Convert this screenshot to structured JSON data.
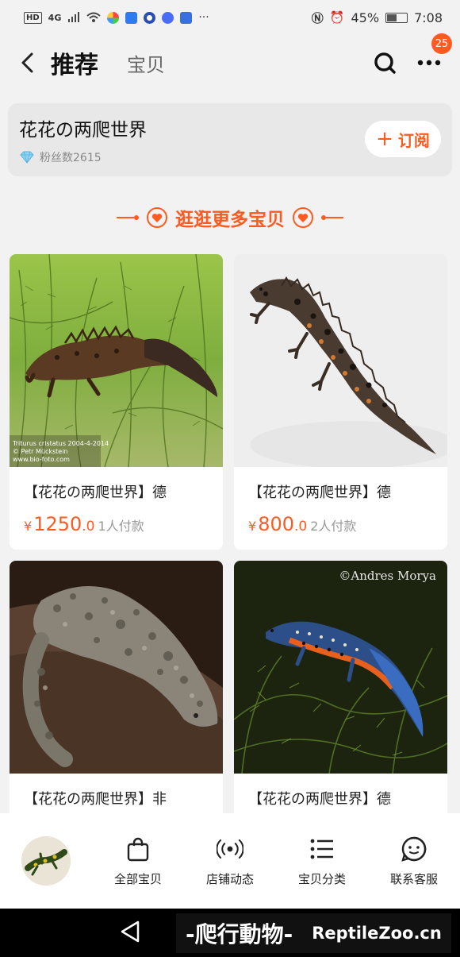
{
  "status_bar": {
    "hd": "HD",
    "signal": "4G",
    "battery_pct": "45%",
    "time": "7:08"
  },
  "header": {
    "title": "推荐",
    "tab_second": "宝贝",
    "more_badge": "25"
  },
  "shop": {
    "name": "花花の两爬世界",
    "fans_label": "粉丝数2615",
    "subscribe_label": "订阅"
  },
  "section": {
    "title": "逛逛更多宝贝"
  },
  "products": [
    {
      "name": "【花花の两爬世界】德",
      "price_symbol": "¥",
      "price_int": "1250",
      "price_dec": ".0",
      "paid": "1人付款",
      "watermark": "Triturus cristatus 2004-4-2014\n© Petr Mückstein\nwww.bio-foto.com"
    },
    {
      "name": "【花花の两爬世界】德",
      "price_symbol": "¥",
      "price_int": "800",
      "price_dec": ".0",
      "paid": "2人付款"
    },
    {
      "name": "【花花の两爬世界】非"
    },
    {
      "name": "【花花の两爬世界】德",
      "watermark": "©Andres Morya"
    }
  ],
  "bottom_nav": [
    {
      "label": "全部宝贝",
      "icon": "bag-icon"
    },
    {
      "label": "店铺动态",
      "icon": "broadcast-icon"
    },
    {
      "label": "宝贝分类",
      "icon": "list-icon"
    },
    {
      "label": "联系客服",
      "icon": "service-icon"
    }
  ],
  "brand": {
    "cn": "-爬行動物-",
    "en": "ReptileZoo.cn"
  },
  "colors": {
    "accent": "#ff5a1f",
    "background": "#f2f2f2"
  }
}
